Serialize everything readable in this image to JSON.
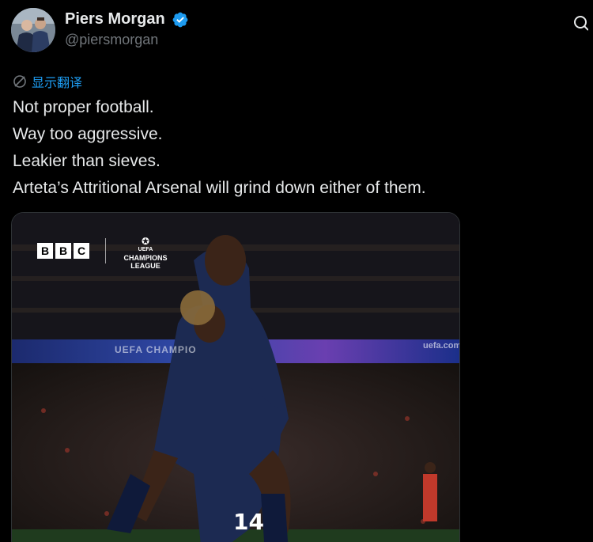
{
  "author": {
    "display_name": "Piers Morgan",
    "handle": "@piersmorgan",
    "avatar_icon": "avatar-photo",
    "verified_icon": "verified-badge-icon",
    "verified_color": "#1d9bf0"
  },
  "header": {
    "more_icon": "more-options-icon"
  },
  "translate": {
    "icon": "translate-icon",
    "label": "显示翻译"
  },
  "tweet": {
    "lines": [
      "Not proper football.",
      "Way too aggressive.",
      "Leakier than sieves.",
      "Arteta’s Attritional Arsenal will grind down either of them."
    ]
  },
  "media": {
    "broadcaster_letters": [
      "B",
      "B",
      "C"
    ],
    "competition_logo_lines": [
      "UEFA",
      "CHAMPIONS",
      "LEAGUE"
    ],
    "banner_text": "UEFA CHAMPIO",
    "banner_text_right": "uefa.com",
    "jersey_number": "14"
  },
  "colors": {
    "background": "#000000",
    "text": "#e7e9ea",
    "secondary_text": "#71767b",
    "link": "#1d9bf0"
  }
}
